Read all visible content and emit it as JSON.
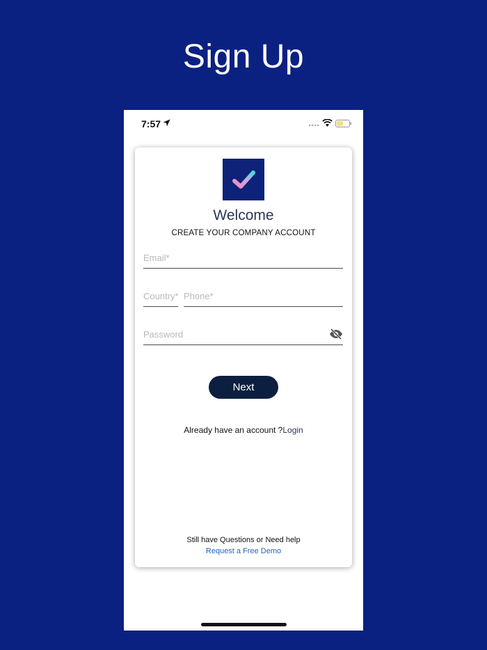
{
  "page": {
    "heading": "Sign Up"
  },
  "status_bar": {
    "time": "7:57",
    "icons": [
      "location-arrow-icon",
      "signal-icon",
      "wifi-icon",
      "battery-icon"
    ]
  },
  "card": {
    "logo_icon": "checkmark-icon",
    "welcome": "Welcome",
    "subtitle": "CREATE YOUR COMPANY ACCOUNT",
    "fields": {
      "email": {
        "placeholder": "Email*",
        "value": ""
      },
      "country": {
        "placeholder": "Country*",
        "value": ""
      },
      "phone": {
        "placeholder": "Phone*",
        "value": ""
      },
      "password": {
        "placeholder": "Password",
        "value": "",
        "toggle_icon": "eye-off-icon"
      }
    },
    "next_label": "Next",
    "account_prompt": "Already have an account ?",
    "login_label": "Login",
    "help_text": "Still have Questions or Need help",
    "demo_label": "Request a Free Demo"
  },
  "colors": {
    "background": "#0b2181",
    "button": "#0c1f40",
    "link": "#1e63c8",
    "logo_bg": "#0d2279"
  }
}
